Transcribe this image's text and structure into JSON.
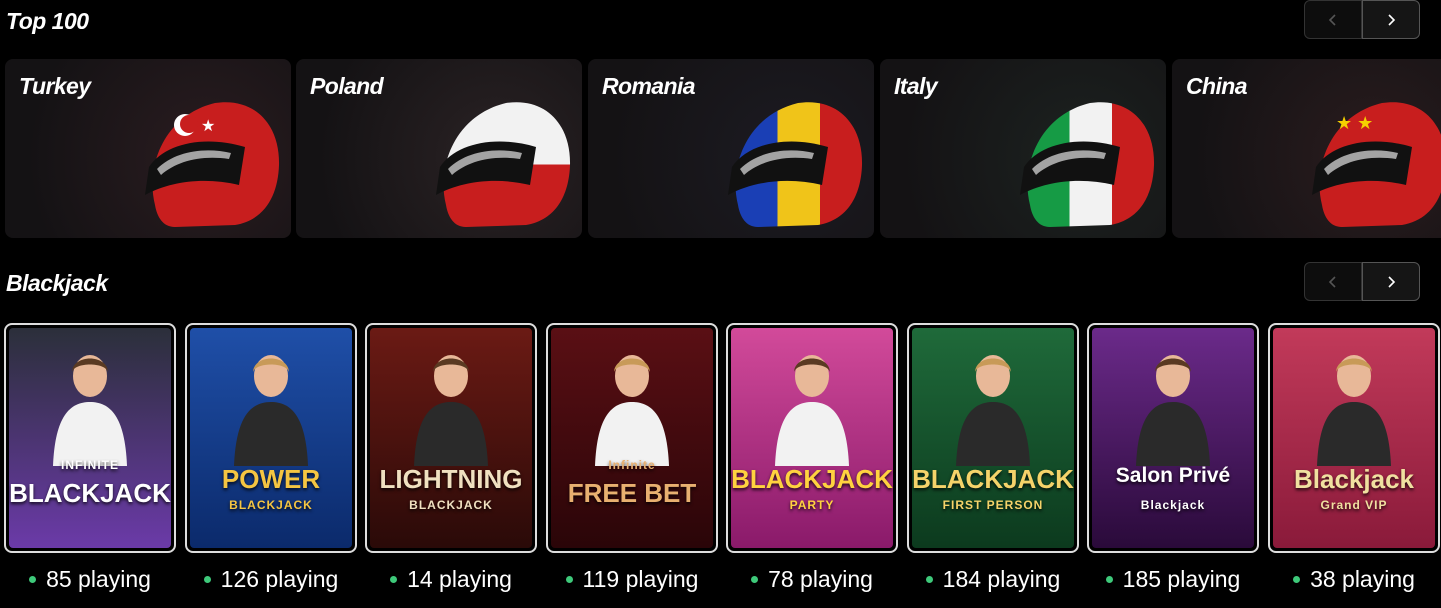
{
  "top100": {
    "title": "Top 100",
    "countries": [
      {
        "name": "Turkey",
        "helmet_colors": [
          "#c81e1e",
          "#c81e1e"
        ],
        "bg": "#2a1c20",
        "emblem": "crescent"
      },
      {
        "name": "Poland",
        "helmet_colors": [
          "#f2f2f2",
          "#c81e1e"
        ],
        "bg": "#2a2224",
        "emblem": "none"
      },
      {
        "name": "Romania",
        "helmet_colors": [
          "#1a3fb5",
          "#f0c419",
          "#c81e1e"
        ],
        "bg": "#1c1b22",
        "emblem": "none"
      },
      {
        "name": "Italy",
        "helmet_colors": [
          "#169b45",
          "#f2f2f2",
          "#c81e1e"
        ],
        "bg": "#1c2220",
        "emblem": "none"
      },
      {
        "name": "China",
        "helmet_colors": [
          "#c81e1e",
          "#c81e1e"
        ],
        "bg": "#2a1c1e",
        "emblem": "stars"
      }
    ]
  },
  "blackjack": {
    "title": "Blackjack",
    "games": [
      {
        "logo": "BLACKJACK",
        "sub": "INFINITE",
        "playing": "85 playing",
        "bg1": "#2b2f3a",
        "bg2": "#6b3aa8",
        "logo_color": "#ffffff"
      },
      {
        "logo": "POWER",
        "sub": "BLACKJACK",
        "playing": "126 playing",
        "bg1": "#1f4fa8",
        "bg2": "#0b2a6b",
        "logo_color": "#f5c542"
      },
      {
        "logo": "LIGHTNING",
        "sub": "BLACKJACK",
        "playing": "14 playing",
        "bg1": "#6b1a14",
        "bg2": "#2a0a08",
        "logo_color": "#f0e0c0"
      },
      {
        "logo": "FREE BET",
        "sub": "Infinite",
        "playing": "119 playing",
        "bg1": "#5a0f14",
        "bg2": "#2a0508",
        "logo_color": "#e8b070"
      },
      {
        "logo": "BLACKJACK",
        "sub": "PARTY",
        "playing": "78 playing",
        "bg1": "#d24a9a",
        "bg2": "#8a1a6a",
        "logo_color": "#ffd23f"
      },
      {
        "logo": "BLACKJACK",
        "sub": "FIRST PERSON",
        "playing": "184 playing",
        "bg1": "#1f6a3a",
        "bg2": "#0c3a1e",
        "logo_color": "#f5d36a"
      },
      {
        "logo": "Salon Privé",
        "sub": "Blackjack",
        "playing": "185 playing",
        "bg1": "#6b2a8a",
        "bg2": "#2a0a3a",
        "logo_color": "#ffffff"
      },
      {
        "logo": "Blackjack",
        "sub": "Grand VIP",
        "playing": "38 playing",
        "bg1": "#c23a5a",
        "bg2": "#8a1a3a",
        "logo_color": "#f0e0a0"
      }
    ]
  }
}
